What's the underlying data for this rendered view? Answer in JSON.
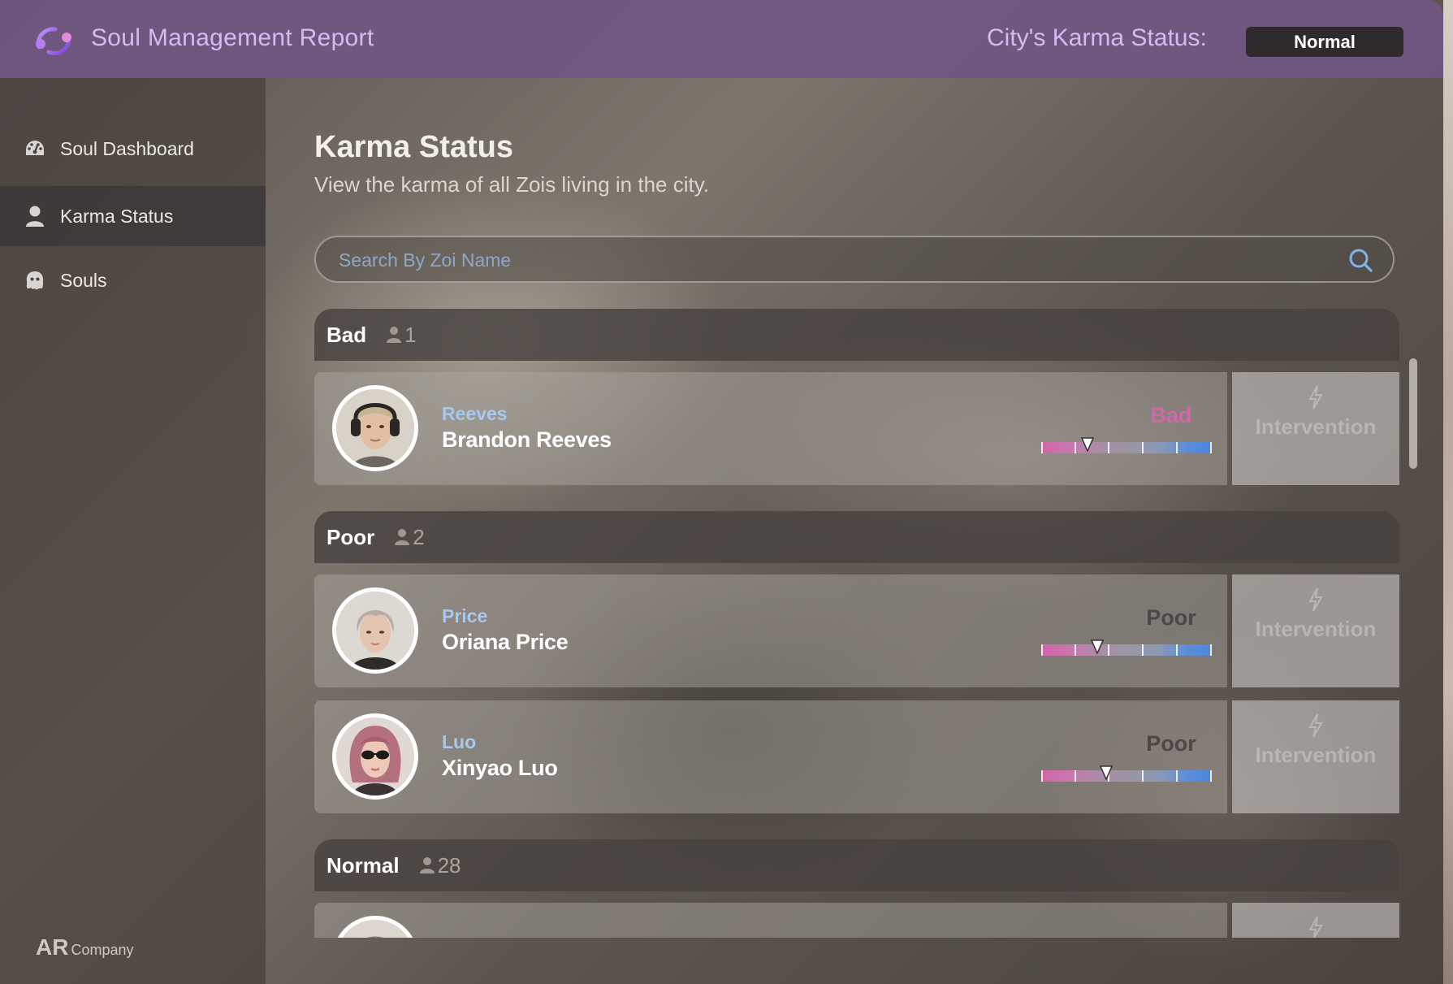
{
  "header": {
    "app_title": "Soul Management Report",
    "city_label": "City's Karma Status:",
    "city_status": "Normal"
  },
  "sidebar": {
    "items": [
      {
        "label": "Soul Dashboard",
        "icon": "dashboard-gauge-icon"
      },
      {
        "label": "Karma Status",
        "icon": "person-icon",
        "active": true
      },
      {
        "label": "Souls",
        "icon": "ghost-icon"
      }
    ],
    "brand_ar": "AR",
    "brand_company": "Company"
  },
  "main": {
    "title": "Karma Status",
    "subtitle": "View the karma of all Zois living in the city.",
    "search_placeholder": "Search By Zoi Name",
    "intervention_label": "Intervention",
    "groups": [
      {
        "name": "Bad",
        "count": "1"
      },
      {
        "name": "Poor",
        "count": "2"
      },
      {
        "name": "Normal",
        "count": "28"
      }
    ],
    "zois": [
      {
        "surname": "Reeves",
        "full_name": "Brandon Reeves",
        "status": "Bad",
        "status_color": "#d067a8",
        "karma_level": 0.27
      },
      {
        "surname": "Price",
        "full_name": "Oriana Price",
        "status": "Poor",
        "status_color": "#4d4747",
        "karma_level": 0.33
      },
      {
        "surname": "Luo",
        "full_name": "Xinyao Luo",
        "status": "Poor",
        "status_color": "#4d4747",
        "karma_level": 0.38
      }
    ]
  },
  "colors": {
    "header_bg": "#705682",
    "accent_lavender": "#d7b9f2",
    "surname_blue": "#a8c8f0",
    "bad_pink": "#d067a8"
  }
}
